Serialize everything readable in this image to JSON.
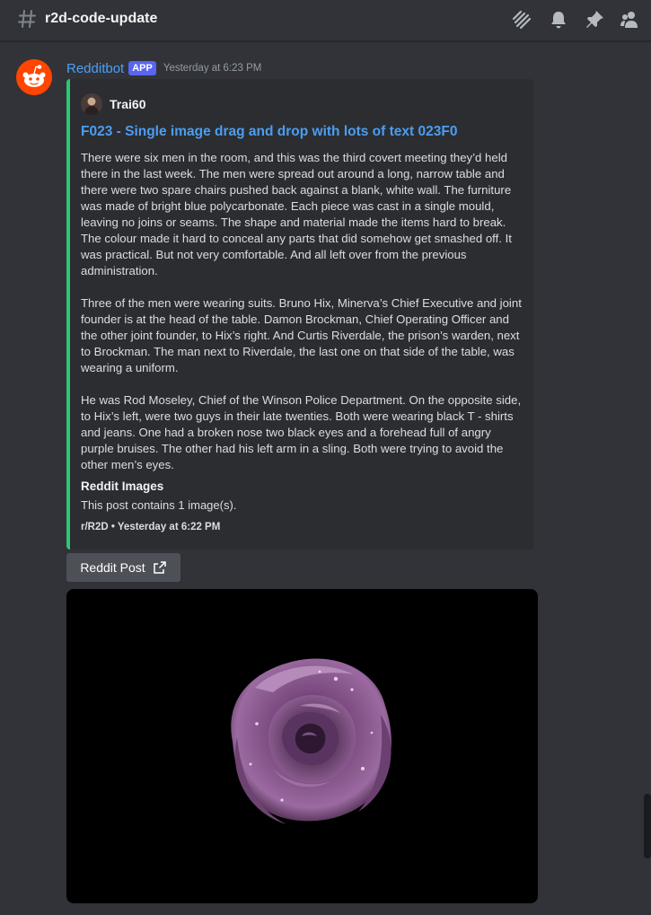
{
  "channel": {
    "name": "r2d-code-update",
    "icon": "hash-icon"
  },
  "toolbar": {
    "icons": [
      "threads-icon",
      "bell-icon",
      "pin-icon",
      "members-icon"
    ]
  },
  "message": {
    "author": "Redditbot",
    "badge": "APP",
    "timestamp": "Yesterday at 6:23 PM",
    "avatar_icon": "reddit-logo-icon",
    "embed": {
      "accent_color": "#2dc770",
      "author_name": "Trai60",
      "title": "F023 - Single image drag and drop with lots of text 023F0",
      "description": [
        "There were six men in the room, and this was the third covert meeting they’d held there in the last week. The men were spread out around a long, narrow table and there were two spare chairs pushed back against a blank, white wall. The furniture was made of bright blue polycarbonate. Each piece was cast in a single mould, leaving no joins or seams. The shape and material made the items hard to break. The colour made it hard to conceal any parts that did somehow get smashed off. It was practical. But not very comfortable. And all left over from the previous administration.",
        "Three of the men were wearing suits. Bruno Hix, Minerva’s Chief Executive and joint founder is at the head of the table. Damon Brockman, Chief Operating Officer and the other joint founder, to Hix’s right. And Curtis Riverdale, the prison’s warden, next to Brockman. The man next to Riverdale, the last one on that side of the table, was wearing a uniform.",
        "He was Rod Moseley, Chief of the Winson Police Department. On the opposite side, to Hix’s left, were two guys in their late twenties. Both were wearing black T - shirts and jeans. One had a broken nose two black eyes and a forehead full of angry purple bruises. The other had his left arm in a sling. Both were trying to avoid the other men’s eyes."
      ],
      "field_name": "Reddit Images",
      "field_value": "This post contains 1 image(s).",
      "footer": "r/R2D • Yesterday at 6:22 PM"
    },
    "link_button": {
      "label": "Reddit Post",
      "icon": "external-link-icon"
    },
    "image": {
      "subject": "purple-rose-image"
    }
  }
}
